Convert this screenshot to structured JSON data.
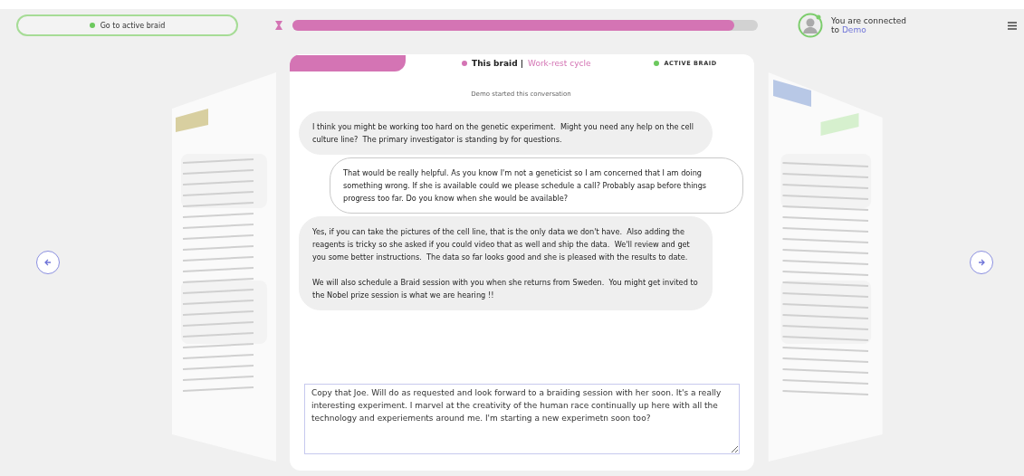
{
  "top_bar": {
    "active_braid_button": {
      "label": "Go to active braid"
    },
    "timer": {
      "level": 0.95
    },
    "connection": {
      "line_1": "You are connected",
      "line_2": "to",
      "user": "Demo"
    }
  },
  "conversation": {
    "braid_label": "This braid |",
    "braid_name": "Work-rest cycle",
    "status": "ACTIVE BRAID",
    "system_message": "Demo started this conversation",
    "messages": [
      {
        "kind": "received",
        "text": "I think you might be working too hard on the genetic experiment.  Might you need any help on the cell culture line?  The primary investigator is standing by for questions."
      },
      {
        "kind": "sent",
        "text": "That would be really helpful. As you know I'm not a geneticist so I am concerned that I am doing something wrong. If she is available could we please schedule a call? Probably asap before things progress too far. Do you know when she would be available?"
      },
      {
        "kind": "received",
        "text": "Yes, if you can take the pictures of the cell line, that is the only data we don't have.  Also adding the reagents is tricky so she asked if you could video that as well and ship the data.  We'll review and get you some better instructions.  The data so far looks good and she is pleased with the results to date.\n\nWe will also schedule a Braid session with you when she returns from Sweden.  You might get invited to the Nobel prize session is what we are hearing !!"
      }
    ],
    "reply": {
      "value": "Copy that Joe. Will do as requested and look forward to a braiding session with her soon. It's a really interesting experiment. I marvel at the creativity of the human race continually up here with all the technology and experiements around me. I'm starting a new experimetn soon too?"
    }
  }
}
